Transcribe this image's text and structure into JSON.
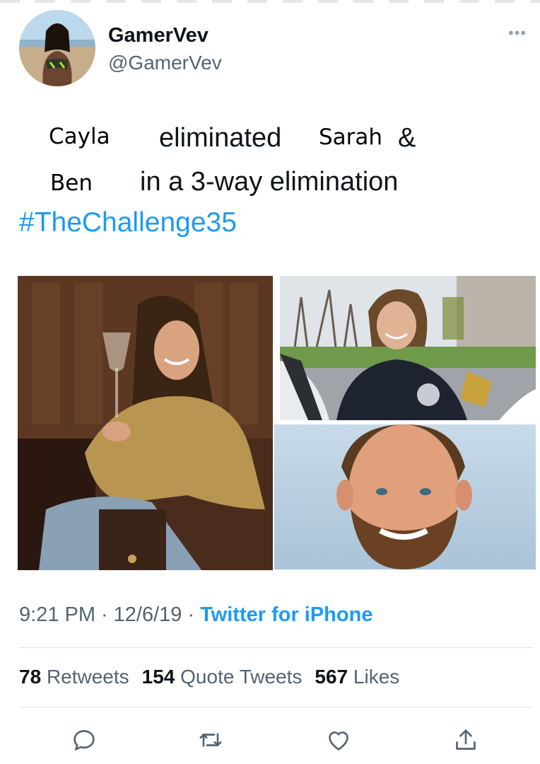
{
  "author": {
    "display_name": "GamerVev",
    "handle": "@GamerVev"
  },
  "more_icon": "ellipsis-icon",
  "tweet": {
    "overlay_names": [
      "Cayla",
      "Sarah",
      "Ben"
    ],
    "line1_text": "eliminated",
    "line1_amp": "&",
    "line2_text": "in a 3-way elimination",
    "hashtag": "#TheChallenge35"
  },
  "meta": {
    "time": "9:21 PM",
    "date": "12/6/19",
    "separator": "·",
    "source": "Twitter for iPhone"
  },
  "stats": {
    "retweets_count": "78",
    "retweets_label": "Retweets",
    "quotes_count": "154",
    "quotes_label": "Quote Tweets",
    "likes_count": "567",
    "likes_label": "Likes"
  },
  "actions": [
    "reply-icon",
    "retweet-icon",
    "like-icon",
    "share-icon"
  ],
  "colors": {
    "link_blue": "#1d9bf0",
    "text_primary": "#0f1419",
    "text_secondary": "#536471",
    "divider": "#dfe3e6"
  }
}
